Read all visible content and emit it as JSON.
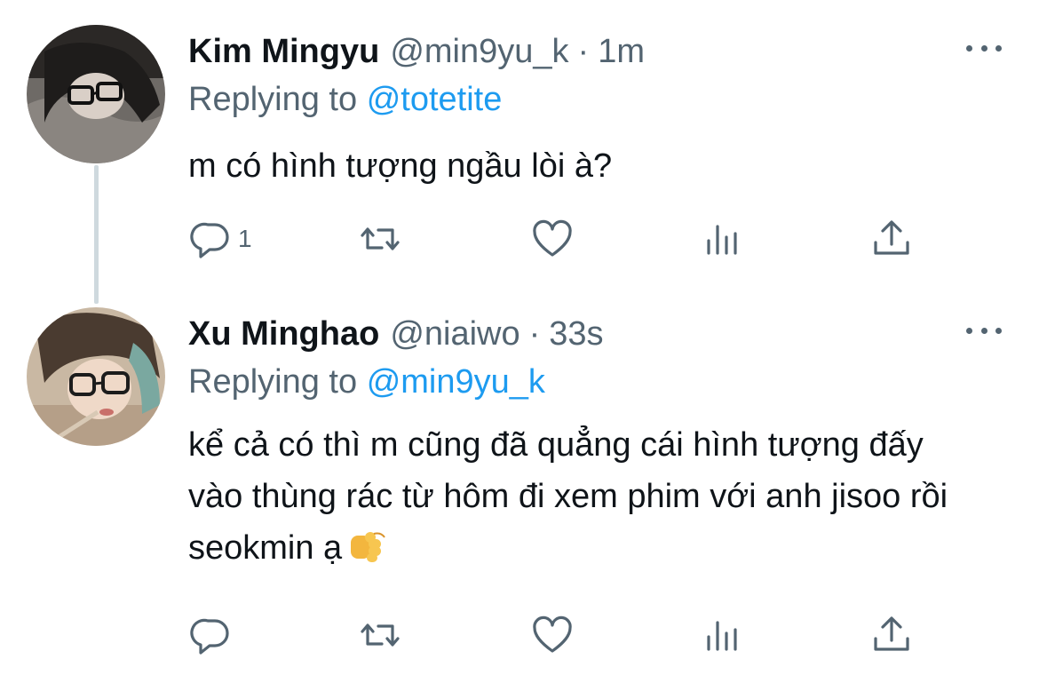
{
  "tweets": [
    {
      "name": "Kim Mingyu",
      "handle": "@min9yu_k",
      "separator": "·",
      "time": "1m",
      "reply_prefix": "Replying to",
      "reply_to": "@totetite",
      "text": "m có hình tượng ngầu lòi à?",
      "reply_count": "1",
      "icons": [
        "reply-icon",
        "retweet-icon",
        "like-icon",
        "analytics-icon",
        "share-icon",
        "more-icon"
      ]
    },
    {
      "name": "Xu Minghao",
      "handle": "@niaiwo",
      "separator": "·",
      "time": "33s",
      "reply_prefix": "Replying to",
      "reply_to": "@min9yu_k",
      "text": "kể cả có thì m cũng đã quẳng cái hình tượng đấy vào thùng rác từ hôm đi xem phim với anh jisoo rồi seokmin ạ",
      "emoji": "oncoming-fist-emoji",
      "reply_count": "",
      "icons": [
        "reply-icon",
        "retweet-icon",
        "like-icon",
        "analytics-icon",
        "share-icon",
        "more-icon"
      ]
    }
  ],
  "colors": {
    "text": "#0f1419",
    "secondary": "#536471",
    "link": "#1d9bf0",
    "thread_line": "#cfd9de"
  }
}
